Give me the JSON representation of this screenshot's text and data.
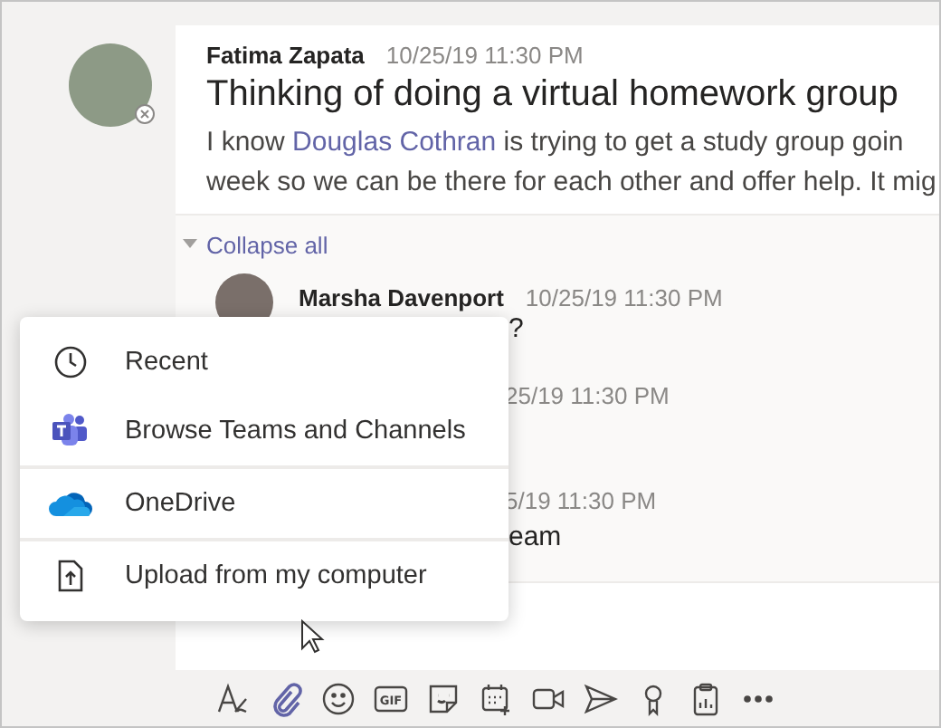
{
  "post": {
    "author": "Fatima Zapata",
    "time": "10/25/19 11:30 PM",
    "title": "Thinking of doing a virtual homework group",
    "body": {
      "before": "I know",
      "mention": "Douglas Cothran",
      "after": "is trying to get a study group goin",
      "line2": "week so we can be there for each other and offer help. It mig"
    }
  },
  "collapse": {
    "label": "Collapse all"
  },
  "replies": [
    {
      "author": "Marsha Davenport",
      "time": "10/25/19 11:30 PM",
      "text": "?"
    },
    {
      "time": "25/19 11:30 PM"
    },
    {
      "time": "5/19 11:30 PM",
      "text": "eam"
    }
  ],
  "attach_menu": [
    {
      "kind": "clock",
      "label": "Recent",
      "divider_before": false
    },
    {
      "kind": "teams",
      "label": "Browse Teams and Channels",
      "divider_before": false
    },
    {
      "kind": "onedrive",
      "label": "OneDrive",
      "divider_before": true
    },
    {
      "kind": "upload",
      "label": "Upload from my computer",
      "divider_before": true
    }
  ],
  "toolbar": [
    {
      "kind": "format",
      "selected": false
    },
    {
      "kind": "attach",
      "selected": true
    },
    {
      "kind": "emoji",
      "selected": false
    },
    {
      "kind": "gif",
      "label": "GIF",
      "selected": false
    },
    {
      "kind": "sticker",
      "selected": false
    },
    {
      "kind": "schedule",
      "selected": false
    },
    {
      "kind": "meet",
      "selected": false
    },
    {
      "kind": "send",
      "selected": false
    },
    {
      "kind": "praise",
      "selected": false
    },
    {
      "kind": "forms",
      "selected": false
    },
    {
      "kind": "more",
      "selected": false
    }
  ]
}
